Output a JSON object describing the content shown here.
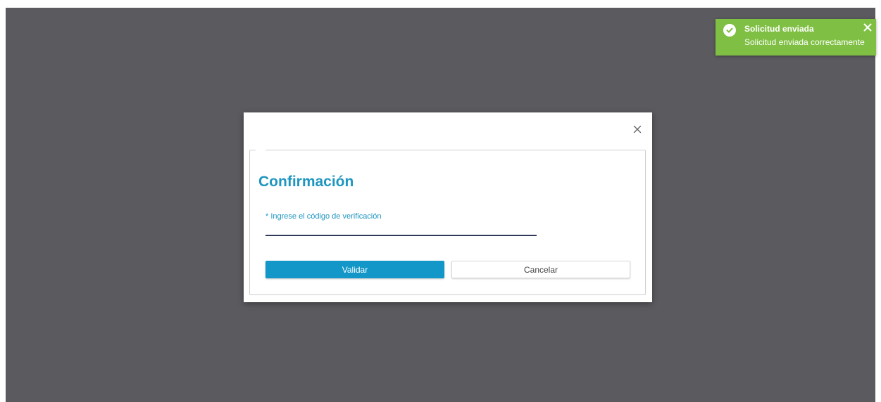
{
  "toast": {
    "title": "Solicitud enviada",
    "message": "Solicitud enviada correctamente",
    "color": "#7fbf43",
    "icon": "check-circle-icon",
    "close_icon": "close-icon"
  },
  "modal": {
    "title": "Confirmación",
    "close_icon": "close-icon",
    "field": {
      "label": "* Ingrese el código de verificación",
      "value": "",
      "placeholder": ""
    },
    "buttons": {
      "primary_label": "Validar",
      "secondary_label": "Cancelar"
    },
    "accent_color": "#1f96c0",
    "primary_button_color": "#1297c8"
  },
  "backdrop_color": "#5b5a5f"
}
